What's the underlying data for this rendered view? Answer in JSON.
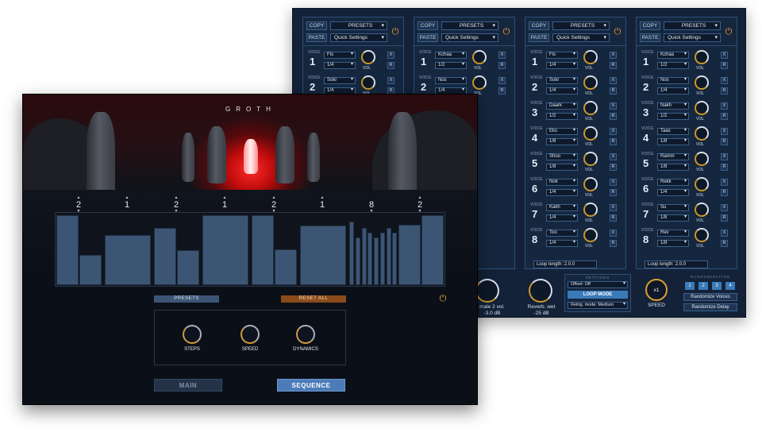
{
  "front": {
    "title": "GROTH",
    "step_counts": [
      "2",
      "1",
      "2",
      "1",
      "2",
      "1",
      "8",
      "2"
    ],
    "presets_label": "PRESETS",
    "reset_label": "RESET ALL",
    "knobs": [
      "STEPS",
      "SPEED",
      "DYNAMICS"
    ],
    "tabs": {
      "main": "MAIN",
      "sequence": "SEQUENCE"
    },
    "colors": {
      "accent": "#c8641e",
      "active_tab": "#4c7cb8",
      "bar": "#3d5575"
    }
  },
  "back": {
    "header": {
      "copy": "COPY",
      "paste": "PASTE",
      "presets": "PRESETS",
      "quick": "Quick Settings"
    },
    "voice_label": "VOICE",
    "vol_label": "VOL",
    "x_label": "X",
    "r_label": "R",
    "columns": [
      {
        "voices": [
          {
            "num": "1",
            "name": "Fis",
            "div": "1/4"
          },
          {
            "num": "2",
            "name": "Sokr",
            "div": "1/4"
          }
        ]
      },
      {
        "voices": [
          {
            "num": "1",
            "name": "Kchaa",
            "div": "1/2"
          },
          {
            "num": "2",
            "name": "Nos",
            "div": "1/4"
          }
        ]
      },
      {
        "voices": [
          {
            "num": "1",
            "name": "Fis",
            "div": "1/4"
          },
          {
            "num": "2",
            "name": "Sokr",
            "div": "1/4"
          },
          {
            "num": "3",
            "name": "Daark",
            "div": "1/2"
          },
          {
            "num": "4",
            "name": "Eks",
            "div": "1/8"
          },
          {
            "num": "5",
            "name": "Shoo",
            "div": "1/8"
          },
          {
            "num": "6",
            "name": "Nok",
            "div": "1/4"
          },
          {
            "num": "7",
            "name": "Kakh",
            "div": "1/4"
          },
          {
            "num": "8",
            "name": "Too",
            "div": "1/4"
          }
        ],
        "loop": "Loop length: 2.0.0"
      },
      {
        "voices": [
          {
            "num": "1",
            "name": "Kchaa",
            "div": "1/2"
          },
          {
            "num": "2",
            "name": "Nos",
            "div": "1/4"
          },
          {
            "num": "3",
            "name": "Nakh",
            "div": "1/2"
          },
          {
            "num": "4",
            "name": "Taas",
            "div": "1/8"
          },
          {
            "num": "5",
            "name": "Ramm",
            "div": "1/8"
          },
          {
            "num": "6",
            "name": "Rekk",
            "div": "1/4"
          },
          {
            "num": "7",
            "name": "Su",
            "div": "1/8"
          },
          {
            "num": "8",
            "name": "Rev",
            "div": "1/8"
          }
        ],
        "loop": "Loop length: 2.0.0"
      }
    ],
    "partial_knob_label": "male 2 vol.",
    "partial_knob_value": "-3.0 dB",
    "reverb_label": "Reverb. wet",
    "reverb_value": "-25 dB",
    "settings": {
      "title": "SETTINGS",
      "offset": "Offset: Off",
      "loop_mode": "LOOP MODE",
      "retrig": "Retrig. mode: Medium"
    },
    "speed_knob": {
      "value": "x1",
      "label": "SPEED"
    },
    "randomization": {
      "title": "RANDOMIZATION",
      "numbers": [
        "1",
        "2",
        "3",
        "4"
      ],
      "voices": "Randomize Voices",
      "delay": "Randomize Delay"
    }
  }
}
